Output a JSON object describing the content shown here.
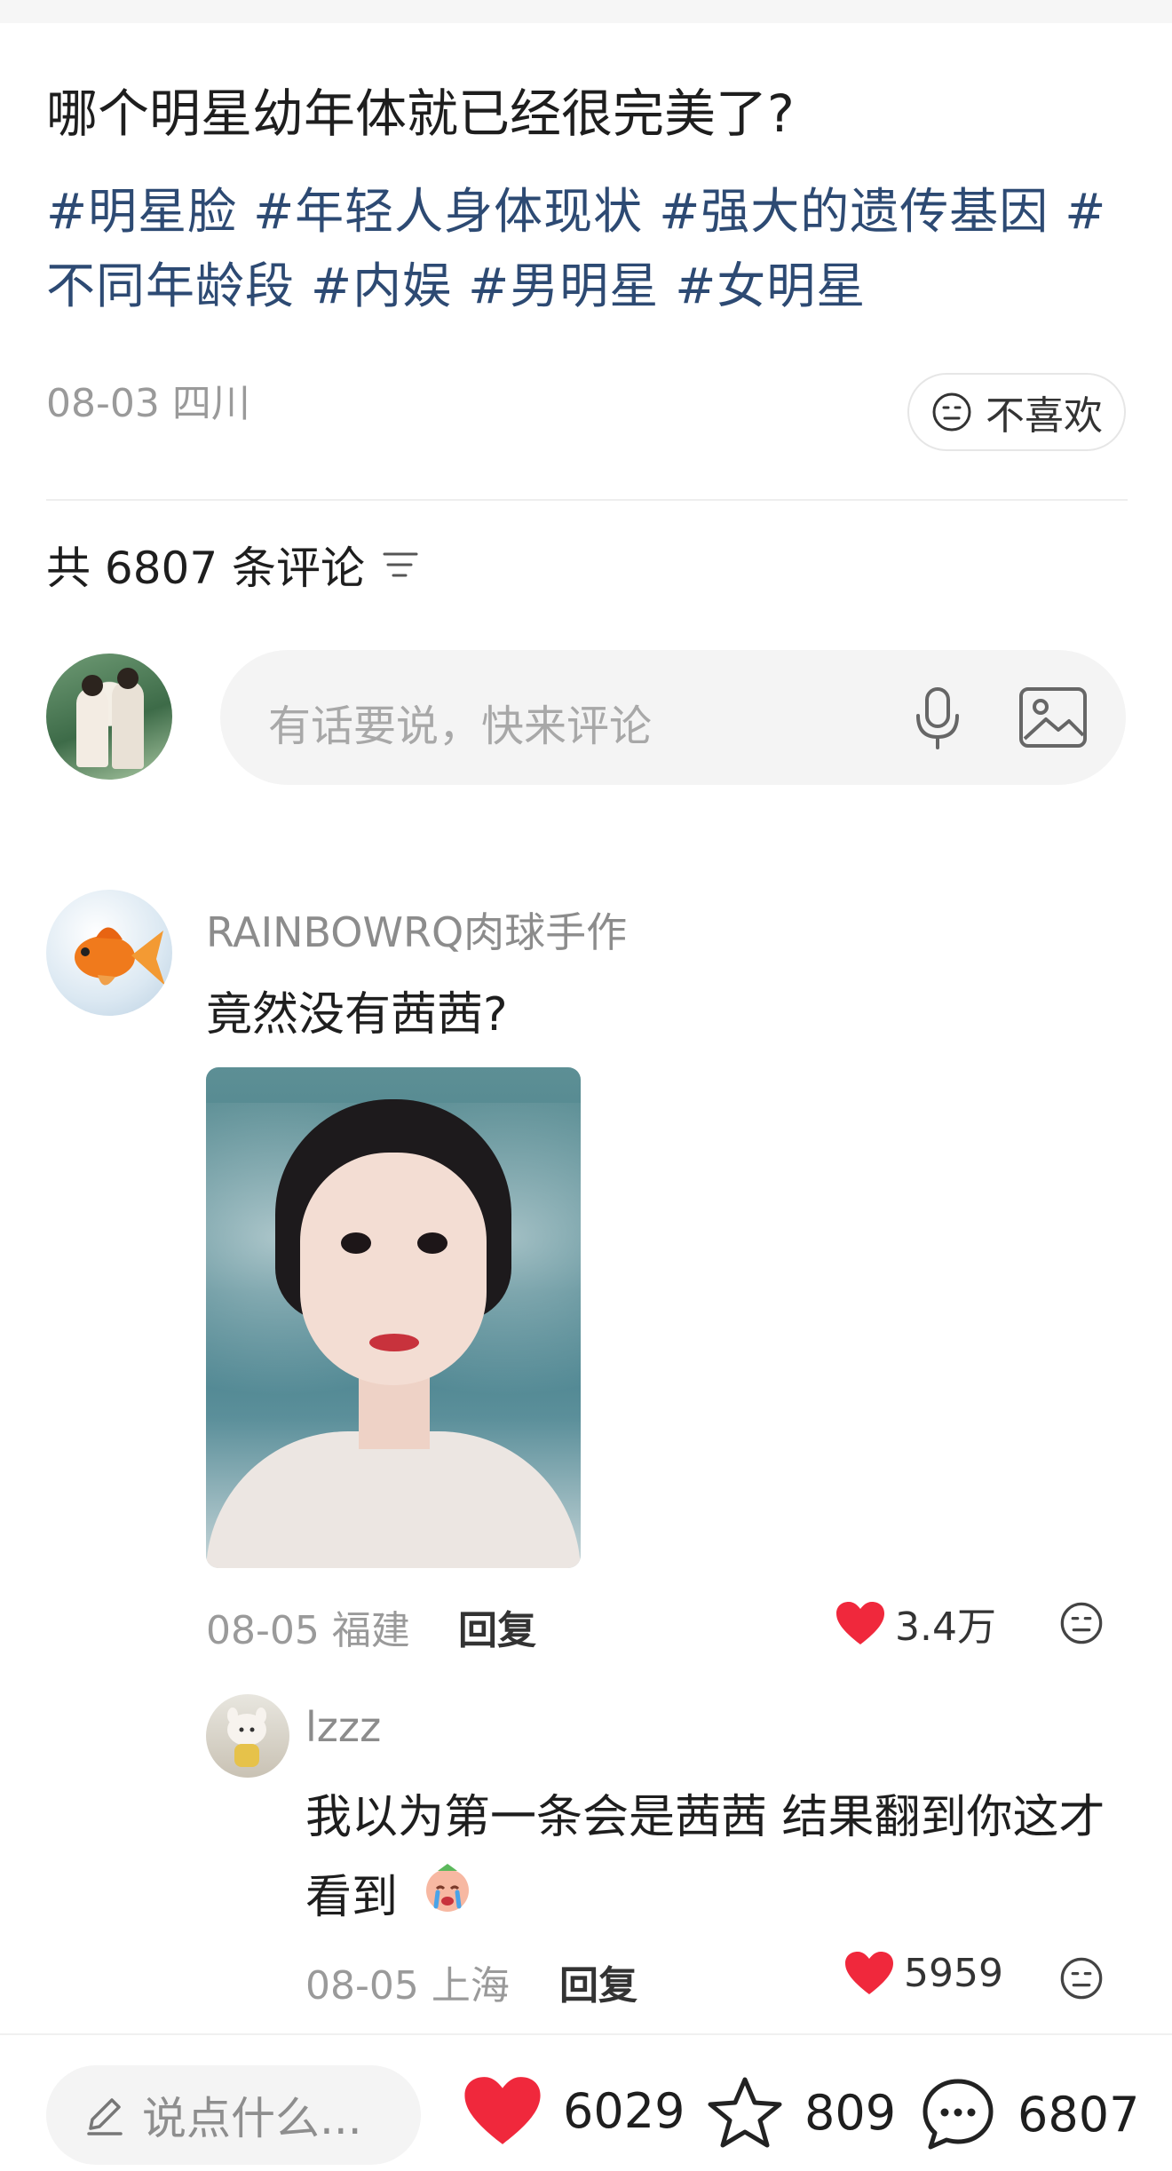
{
  "post": {
    "title": "哪个明星幼年体就已经很完美了?",
    "tags": [
      "#明星脸",
      "#年轻人身体现状",
      "#强大的遗传基因",
      "#不同年龄段",
      "#内娱",
      "#男明星",
      "#女明星"
    ],
    "date_location": "08-03 四川",
    "dislike_label": "不喜欢"
  },
  "comments_header": {
    "count_text": "共 6807 条评论"
  },
  "comment_input": {
    "placeholder": "有话要说，快来评论"
  },
  "comments": [
    {
      "user": "RAINBOWRQ肉球手作",
      "text": "竟然没有茜茜?",
      "date_location": "08-05 福建",
      "reply_label": "回复",
      "likes": "3.4万",
      "replies": [
        {
          "user": "lzzz",
          "text": "我以为第一条会是茜茜 结果翻到你这才看到",
          "date_location": "08-05 上海",
          "reply_label": "回复",
          "likes": "5959"
        }
      ]
    }
  ],
  "bottom_bar": {
    "say_placeholder": "说点什么...",
    "likes": "6029",
    "favorites": "809",
    "comments": "6807"
  },
  "colors": {
    "tag_blue": "#2d4a73",
    "like_red": "#f0283c",
    "muted_gray": "#9a9a9a"
  }
}
